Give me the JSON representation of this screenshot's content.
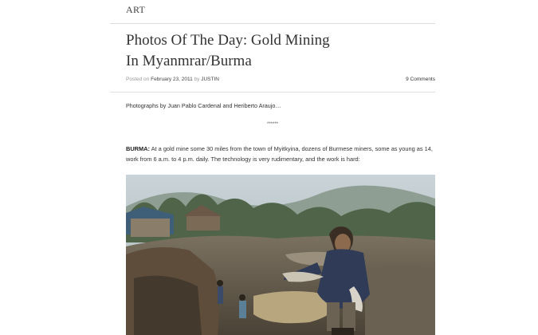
{
  "header": {
    "category": "ART"
  },
  "post": {
    "title_line1": "Photos Of The Day: Gold Mining",
    "title_line2": "In Myanmrar/Burma",
    "posted_on": "Posted on",
    "date": "February 23, 2011",
    "by": "by",
    "author": "JUSTIN",
    "comments": "9 Comments",
    "credit": "Photographs by Juan Pablo Cardenal and Heriberto Araujo…",
    "separator": "******",
    "lead": "BURMA:",
    "body": " At a gold mine some 30 miles from the town of Myitkyina, dozens of Burmese miners, some as young as 14, work from 6 a.m. to 4 p.m. daily. The technology is very rudimentary, and the work is hard:"
  },
  "colors": {
    "text": "#333333",
    "rule": "#dcdcdc",
    "meta": "#999999"
  }
}
